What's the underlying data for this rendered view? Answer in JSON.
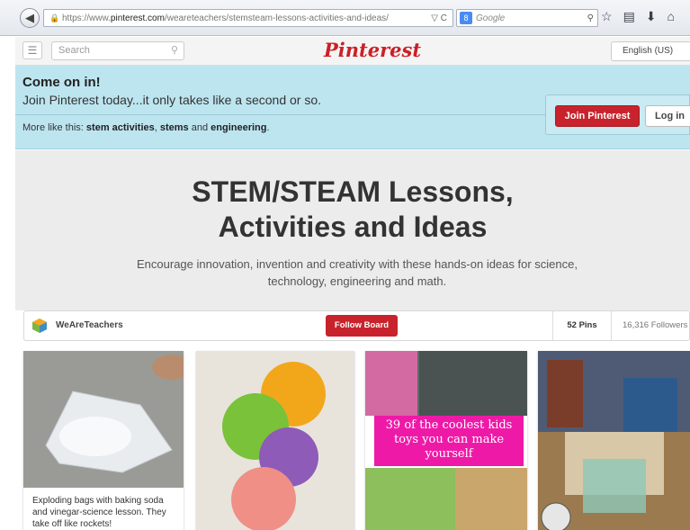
{
  "browser": {
    "url_prefix": "https://www.",
    "url_domain": "pinterest.com",
    "url_path": "/weareteachers/stemsteam-lessons-activities-and-ideas/",
    "search_engine_placeholder": "Google"
  },
  "topbar": {
    "search_placeholder": "Search",
    "logo": "Pinterest",
    "language": "English (US)"
  },
  "banner": {
    "title": "Come on in!",
    "subtitle": "Join Pinterest today...it only takes like a second or so.",
    "more_prefix": "More like this: ",
    "tags": [
      "stem activities",
      "stems",
      "engineering"
    ],
    "join_label": "Join Pinterest",
    "login_label": "Log in"
  },
  "board": {
    "title_line1": "STEM/STEAM Lessons,",
    "title_line2": "Activities and Ideas",
    "description": "Encourage innovation, invention and creativity with these hands-on ideas for science, technology, engineering and math.",
    "owner": "WeAreTeachers",
    "follow_label": "Follow Board",
    "pins_count": "52 Pins",
    "followers_count": "16,316 Followers"
  },
  "pins": [
    {
      "caption": "Exploding bags with baking soda and vinegar-science lesson. They take off like rockets!"
    },
    {
      "caption": ""
    },
    {
      "caption": "",
      "overlay": "39 of the coolest kids toys you can make yourself"
    },
    {
      "caption": ""
    }
  ],
  "colors": {
    "brand_red": "#cb2027",
    "banner_blue": "#bde5f0",
    "overlay_pink": "#ee1aa7"
  }
}
